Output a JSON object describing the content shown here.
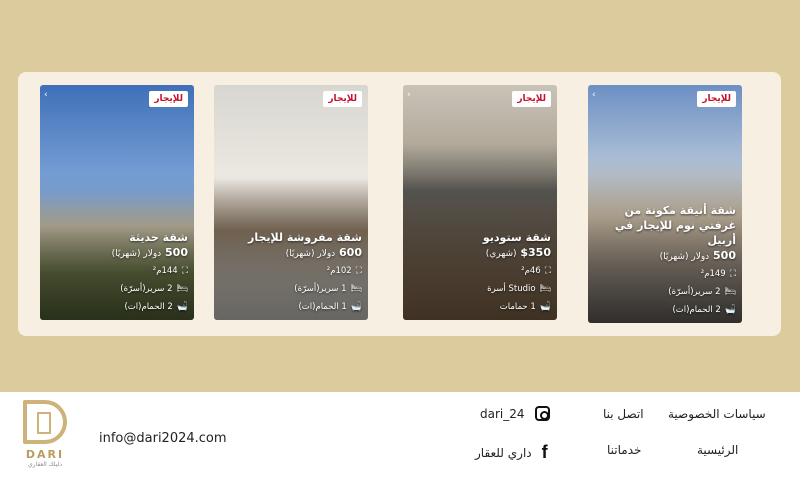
{
  "badge_label": "للإيجار",
  "cards": [
    {
      "title": "شقة حديثة",
      "price": "500",
      "price_note": "دولار (شهريًا)",
      "area": "144م²",
      "beds": "2 سرير(أسرّة)",
      "baths": "2 الحمام(ات)"
    },
    {
      "title": "شقة مفروشة للإيجار",
      "price": "600",
      "price_note": "دولار (شهريًا)",
      "area": "102م²",
      "beds": "1 سرير(أسرّة)",
      "baths": "1 الحمام(ات)"
    },
    {
      "title": "شقة ستوديو",
      "price": "$350",
      "price_note": "(شهري)",
      "area": "46م²",
      "beds": "Studio أسرة",
      "baths": "1 حمامات"
    },
    {
      "title": "شقة أنيقة مكونة من غرفتي نوم للإيجار في أربيل",
      "price": "500",
      "price_note": "دولار (شهريًا)",
      "area": "149م²",
      "beds": "2 سرير(أسرّة)",
      "baths": "2 الحمام(ات)"
    }
  ],
  "footer": {
    "brand": "DARI",
    "tagline": "دليلك العقاري",
    "email": "info@dari2024.com",
    "instagram": "dari_24",
    "facebook": "داري للعقار",
    "links": {
      "contact": "اتصل بنا",
      "services": "خدماتنا",
      "privacy": "سياسات الخصوصية",
      "home": "الرئيسية"
    }
  }
}
